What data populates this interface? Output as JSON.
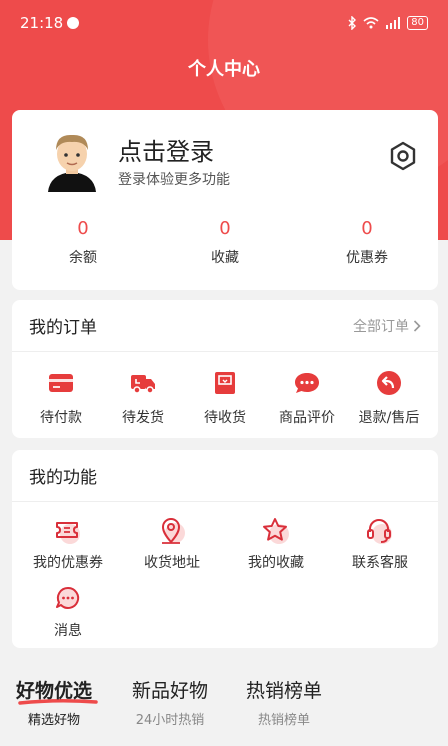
{
  "status_bar": {
    "time": "21:18",
    "battery": "80"
  },
  "header": {
    "title": "个人中心"
  },
  "profile": {
    "login_title": "点击登录",
    "login_subtitle": "登录体验更多功能",
    "stats": [
      {
        "value": "0",
        "label": "余额"
      },
      {
        "value": "0",
        "label": "收藏"
      },
      {
        "value": "0",
        "label": "优惠券"
      }
    ]
  },
  "orders": {
    "title": "我的订单",
    "all_link": "全部订单",
    "items": [
      {
        "label": "待付款",
        "icon": "card-icon"
      },
      {
        "label": "待发货",
        "icon": "truck-icon"
      },
      {
        "label": "待收货",
        "icon": "box-icon"
      },
      {
        "label": "商品评价",
        "icon": "comment-icon"
      },
      {
        "label": "退款/售后",
        "icon": "return-icon"
      }
    ]
  },
  "functions": {
    "title": "我的功能",
    "items": [
      {
        "label": "我的优惠券",
        "icon": "ticket-icon"
      },
      {
        "label": "收货地址",
        "icon": "location-icon"
      },
      {
        "label": "我的收藏",
        "icon": "star-icon"
      },
      {
        "label": "联系客服",
        "icon": "headset-icon"
      },
      {
        "label": "消息",
        "icon": "message-icon"
      }
    ]
  },
  "tabs": [
    {
      "title": "好物优选",
      "subtitle": "精选好物",
      "active": true
    },
    {
      "title": "新品好物",
      "subtitle": "24小时热销",
      "active": false
    },
    {
      "title": "热销榜单",
      "subtitle": "热销榜单",
      "active": false
    }
  ],
  "colors": {
    "accent": "#ee4b4b",
    "background": "#f2f2f2"
  }
}
